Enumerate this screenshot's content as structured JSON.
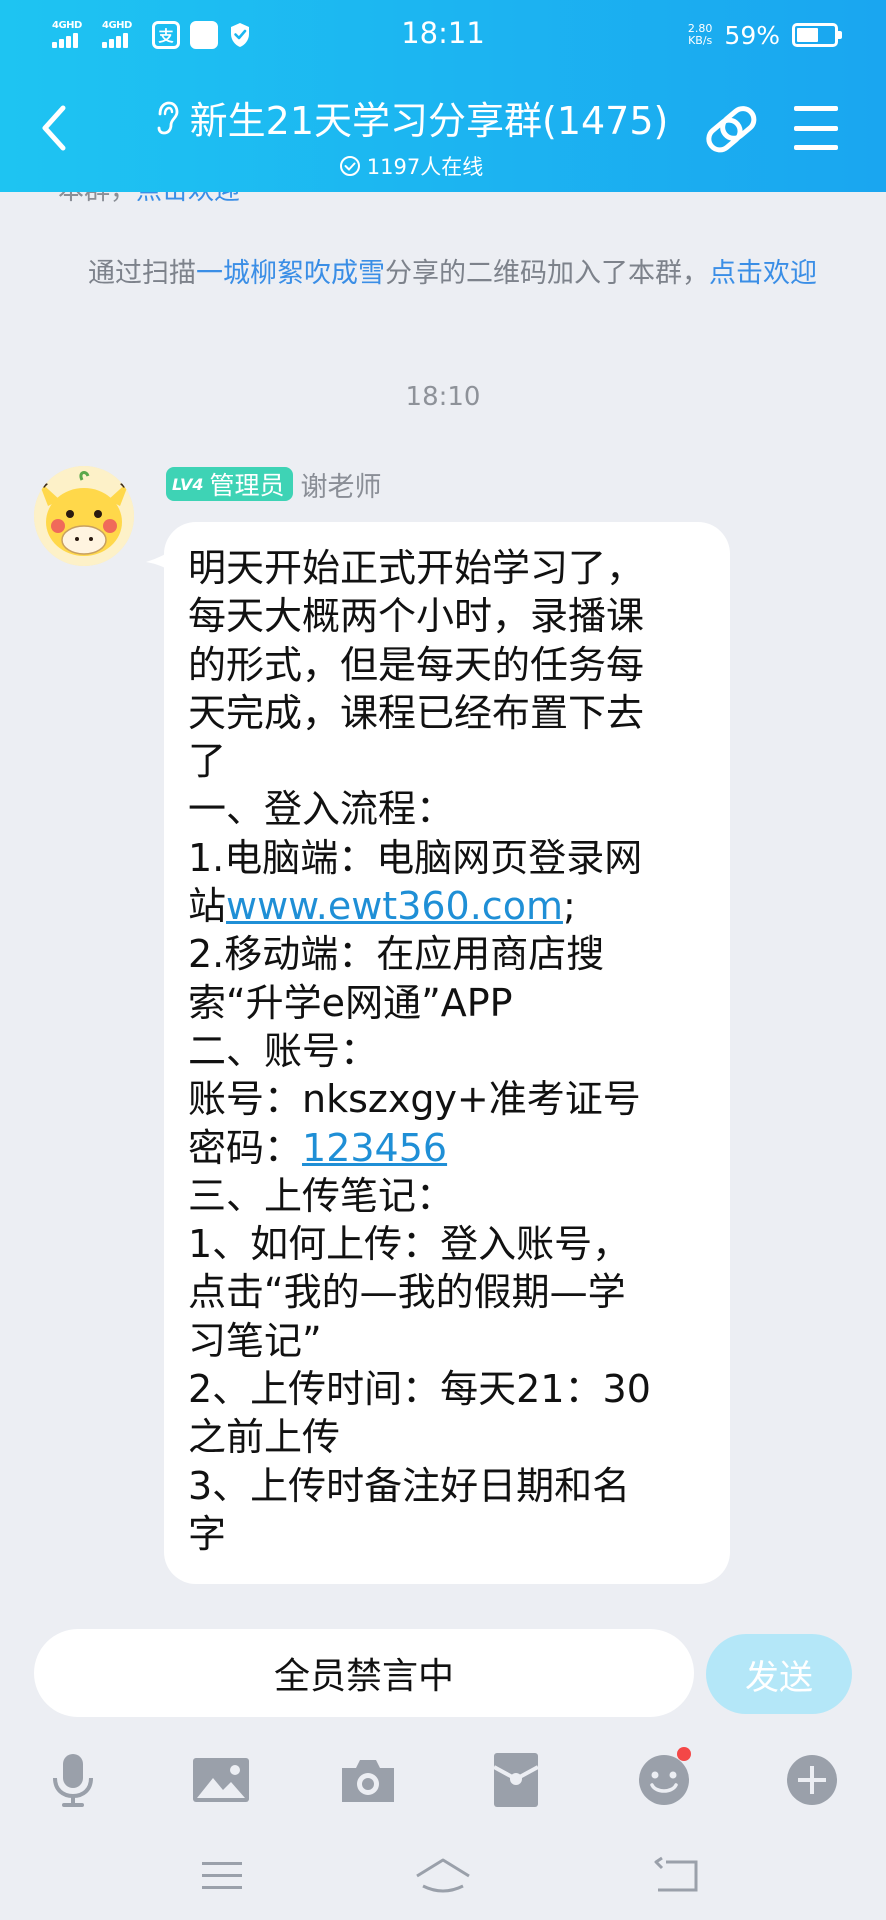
{
  "status_bar": {
    "network_1": "4GHD",
    "network_2": "4GHD",
    "app_icon_1": "支",
    "time": "18:11",
    "speed_value": "2.80",
    "speed_unit": "KB/s",
    "battery_percent": "59%",
    "battery_level": 0.59
  },
  "header": {
    "title": "新生21天学习分享群(1475)",
    "online_status": "1197人在线",
    "icons": [
      "back-arrow-icon",
      "ear-icon",
      "link-icon",
      "menu-icon"
    ]
  },
  "chat": {
    "system_cut_text": "本群，",
    "system_cut_link": "点击欢迎",
    "system_message": {
      "prefix": "通过扫描",
      "user": "一城柳絮吹成雪",
      "middle": "分享的二维码加入了本群，",
      "link": "点击欢迎"
    },
    "time_separator": "18:10",
    "message": {
      "level_badge": "LV4",
      "role_badge": "管理员",
      "sender": "谢老师",
      "lines": [
        "明天开始正式开始学习了，",
        "每天大概两个小时，录播课",
        "的形式，但是每天的任务每",
        "天完成，课程已经布置下去",
        "了",
        "一、登入流程：",
        "1.电脑端：电脑网页登录网",
        "2.移动端：在应用商店搜",
        "索“升学e网通”APP",
        "二、账号：",
        "账号：nkszxgy+准考证号",
        "三、上传笔记：",
        "1、如何上传：登入账号，",
        "点击“我的—我的假期—学",
        "习笔记”",
        "2、上传时间：每天21：30",
        "之前上传",
        "3、上传时备注好日期和名",
        "字"
      ],
      "site_prefix": "站",
      "site_url": "www.ewt360.com",
      "site_suffix": ";",
      "password_label": "密码：",
      "password_value": "123456"
    }
  },
  "input_bar": {
    "muted_text": "全员禁言中",
    "send_label": "发送",
    "toolbar_icons": [
      "microphone-icon",
      "image-icon",
      "camera-icon",
      "red-packet-icon",
      "emoji-icon",
      "plus-icon"
    ]
  },
  "colors": {
    "header_start": "#1ec4f2",
    "header_end": "#1aa6f0",
    "link": "#3a8ee6",
    "badge": "#3ed3b5",
    "send_disabled": "#b4e7f8",
    "background": "#eceef3"
  }
}
